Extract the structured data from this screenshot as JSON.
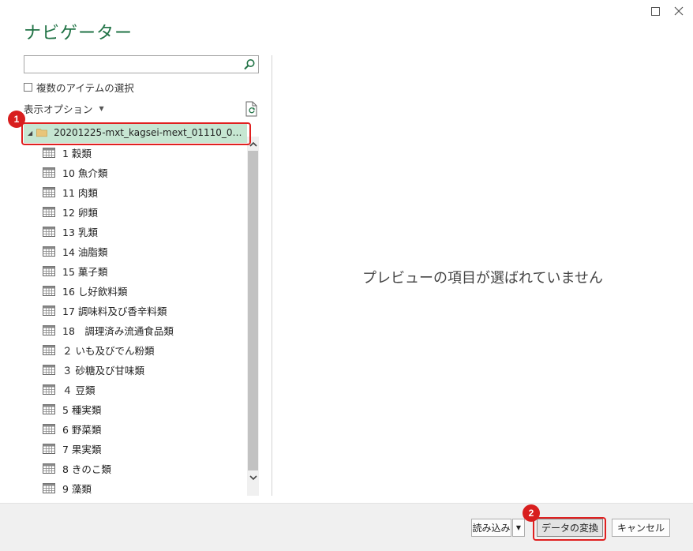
{
  "dialog": {
    "title": "ナビゲーター",
    "multi_select_label": "複数のアイテムの選択",
    "display_options_label": "表示オプション",
    "preview_message": "プレビューの項目が選ばれていません"
  },
  "search": {
    "value": "",
    "placeholder": ""
  },
  "tree": {
    "folder_label": "20201225-mxt_kagsei-mext_01110_012.xlsx...",
    "items": [
      "1 穀類",
      "10 魚介類",
      "11 肉類",
      "12 卵類",
      "13 乳類",
      "14 油脂類",
      "15 菓子類",
      "16 し好飲料類",
      "17 調味料及び香辛料類",
      "18　調理済み流通食品類",
      "２ いも及びでん粉類",
      "３ 砂糖及び甘味類",
      "４ 豆類",
      "5 種実類",
      "6 野菜類",
      "7 果実類",
      "8 きのこ類",
      "9 藻類"
    ]
  },
  "footer": {
    "load_label": "読み込み",
    "transform_label": "データの変換",
    "cancel_label": "キャンセル"
  },
  "annotations": {
    "badge_1": "1",
    "badge_2": "2"
  },
  "colors": {
    "accent": "#217346",
    "selected_bg": "#c6e6d2",
    "highlight": "#e02020"
  }
}
